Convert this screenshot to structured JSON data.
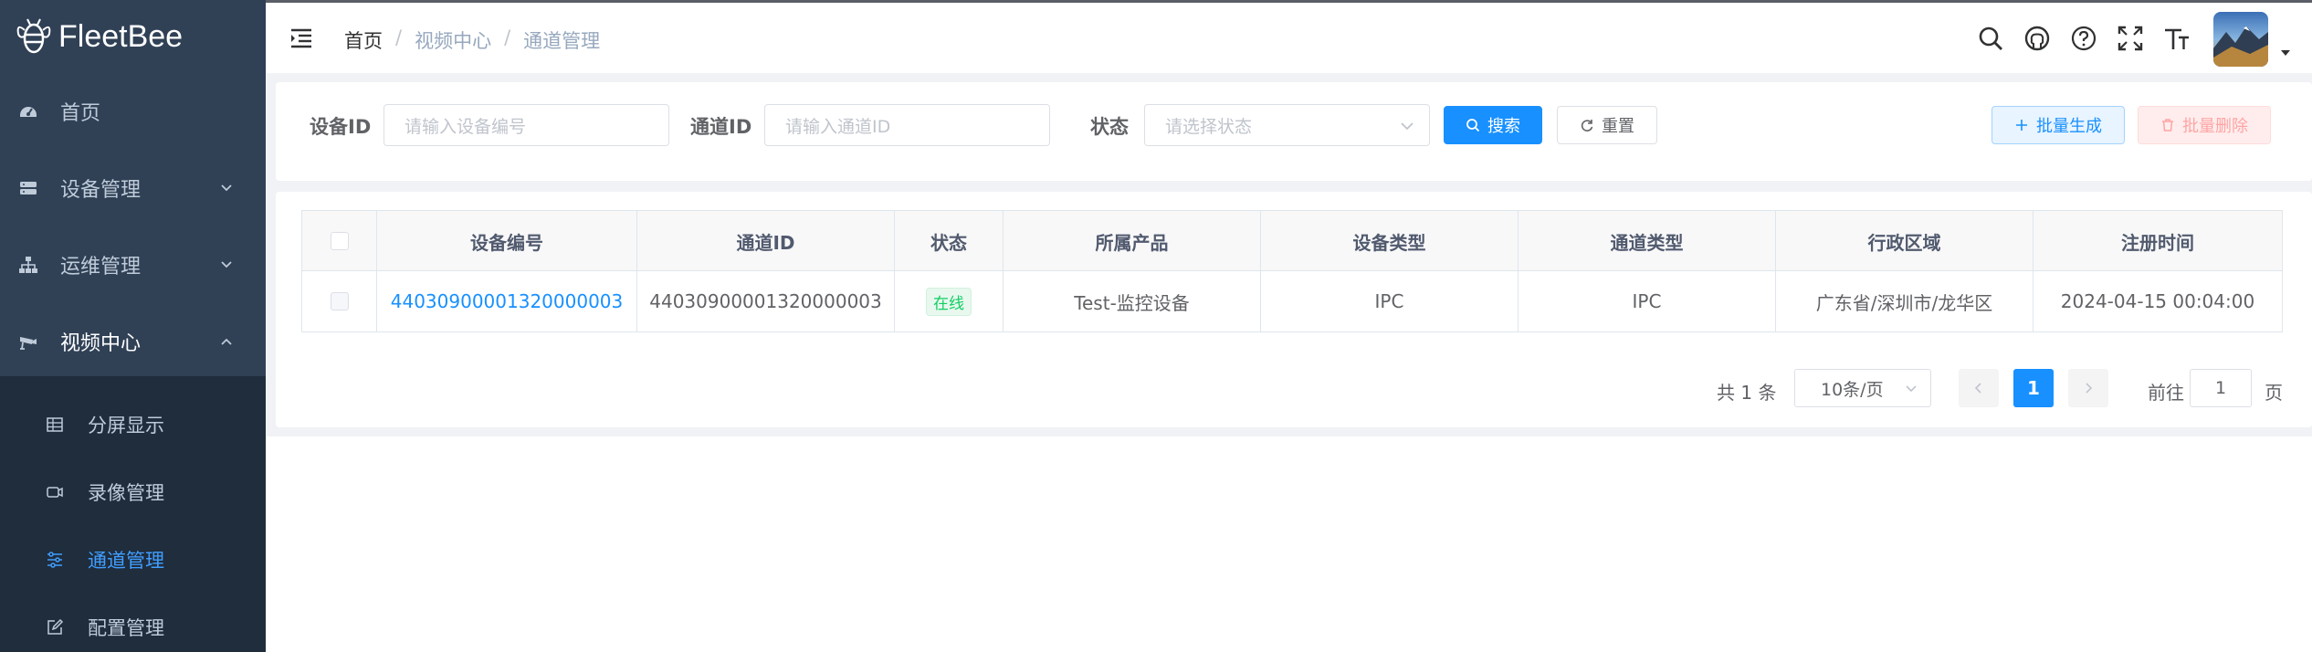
{
  "app": {
    "name": "FleetBee"
  },
  "sidebar": {
    "items": [
      {
        "label": "首页",
        "icon": "dashboard-icon"
      },
      {
        "label": "设备管理",
        "icon": "server-icon"
      },
      {
        "label": "运维管理",
        "icon": "tree-icon"
      },
      {
        "label": "视频中心",
        "icon": "camera-icon"
      }
    ],
    "video_submenu": [
      {
        "label": "分屏显示",
        "icon": "grid-icon"
      },
      {
        "label": "录像管理",
        "icon": "video-icon"
      },
      {
        "label": "通道管理",
        "icon": "sliders-icon",
        "active": true
      },
      {
        "label": "配置管理",
        "icon": "edit-icon"
      }
    ]
  },
  "header": {
    "breadcrumb": [
      "首页",
      "视频中心",
      "通道管理"
    ],
    "icons": [
      "search-icon",
      "github-icon",
      "help-icon",
      "fullscreen-icon",
      "font-size-icon"
    ]
  },
  "search": {
    "device_id_label": "设备ID",
    "device_id_placeholder": "请输入设备编号",
    "channel_id_label": "通道ID",
    "channel_id_placeholder": "请输入通道ID",
    "status_label": "状态",
    "status_placeholder": "请选择状态",
    "search_button": "搜索",
    "reset_button": "重置",
    "batch_generate_button": "批量生成",
    "batch_delete_button": "批量删除"
  },
  "table": {
    "columns": [
      "设备编号",
      "通道ID",
      "状态",
      "所属产品",
      "设备类型",
      "通道类型",
      "行政区域",
      "注册时间"
    ],
    "rows": [
      {
        "device_no": "44030900001320000003",
        "channel_id": "44030900001320000003",
        "status": "在线",
        "product": "Test-监控设备",
        "device_type": "IPC",
        "channel_type": "IPC",
        "region": "广东省/深圳市/龙华区",
        "registered": "2024-04-15 00:04:00"
      }
    ]
  },
  "pagination": {
    "total": "共 1 条",
    "page_size": "10条/页",
    "current": "1",
    "goto_label": "前往",
    "goto_value": "1",
    "page_label": "页"
  },
  "colors": {
    "sidebar_bg": "#304156",
    "submenu_bg": "#1f2d3d",
    "primary": "#1890ff",
    "success": "#13ce66",
    "danger": "#ff4949"
  }
}
